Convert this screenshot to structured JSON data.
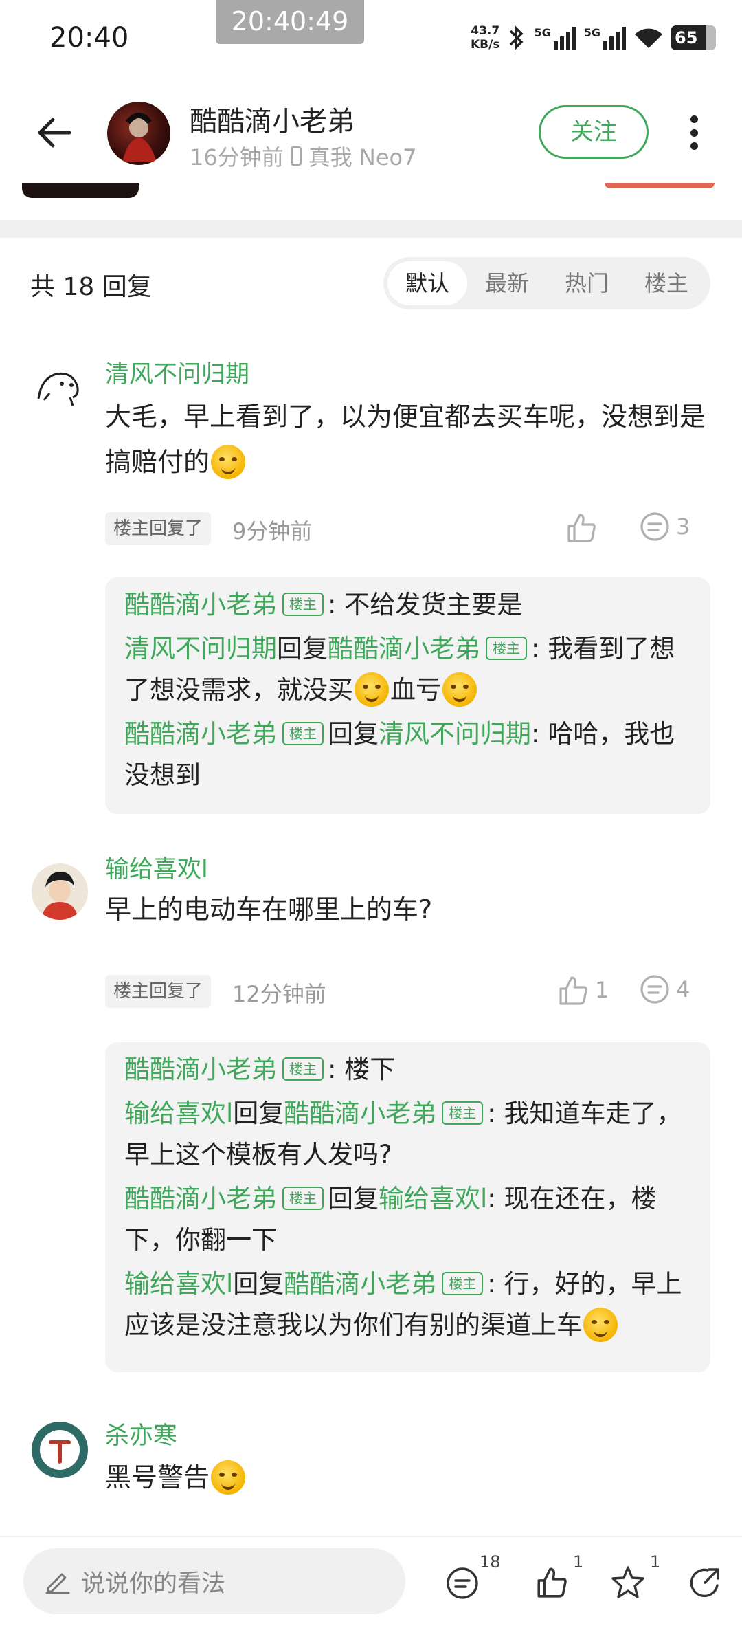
{
  "status_bar": {
    "time": "20:40",
    "time_pill": "20:40:49",
    "net_speed_value": "43.7",
    "net_speed_unit": "KB/s",
    "sim1": "5G",
    "sim2": "5G",
    "battery": "65"
  },
  "header": {
    "author_name": "酷酷滴小老弟",
    "post_time": "16分钟前",
    "device": "真我 Neo7",
    "follow_label": "关注"
  },
  "replies": {
    "count_label": "共 18 回复",
    "sort_tabs": [
      "默认",
      "最新",
      "热门",
      "楼主"
    ],
    "active_tab": "默认"
  },
  "op_badge": "楼主",
  "reply_word": "回复",
  "comments": [
    {
      "user": "清风不问归期",
      "text": "大毛，早上看到了，以为便宜都去买车呢，没想到是搞赔付的",
      "op_replied": "楼主回复了",
      "time": "9分钟前",
      "likes": "",
      "reply_count": "3",
      "sub_replies": [
        {
          "user": "酷酷滴小老弟",
          "text": ": 不给发货主要是"
        },
        {
          "user": "清风不问归期",
          "target": "酷酷滴小老弟",
          "text": ": 我看到了想了想没需求，就没买",
          "text2": "血亏"
        },
        {
          "user": "酷酷滴小老弟",
          "target": "清风不问归期",
          "text": ": 哈哈，我也没想到"
        }
      ]
    },
    {
      "user": "输给喜欢l",
      "text": "早上的电动车在哪里上的车?",
      "op_replied": "楼主回复了",
      "time": "12分钟前",
      "likes": "1",
      "reply_count": "4",
      "sub_replies": [
        {
          "user": "酷酷滴小老弟",
          "text": ": 楼下"
        },
        {
          "user": "输给喜欢l",
          "target": "酷酷滴小老弟",
          "text": ": 我知道车走了，早上这个模板有人发吗?"
        },
        {
          "user": "酷酷滴小老弟",
          "target": "输给喜欢l",
          "text": ": 现在还在，楼下，你翻一下"
        },
        {
          "user": "输给喜欢l",
          "target": "酷酷滴小老弟",
          "text": ": 行，好的，早上应该是没注意我以为你们有别的渠道上车"
        }
      ]
    },
    {
      "user": "杀亦寒",
      "text": "黑号警告"
    }
  ],
  "bottom_bar": {
    "input_placeholder": "说说你的看法",
    "comment_count": "18",
    "like_count": "1",
    "star_count": "1"
  },
  "colors": {
    "accent_green": "#3fa85a",
    "text_primary": "#222222",
    "text_secondary": "#999999",
    "reply_box_bg": "#f3f3f3"
  }
}
